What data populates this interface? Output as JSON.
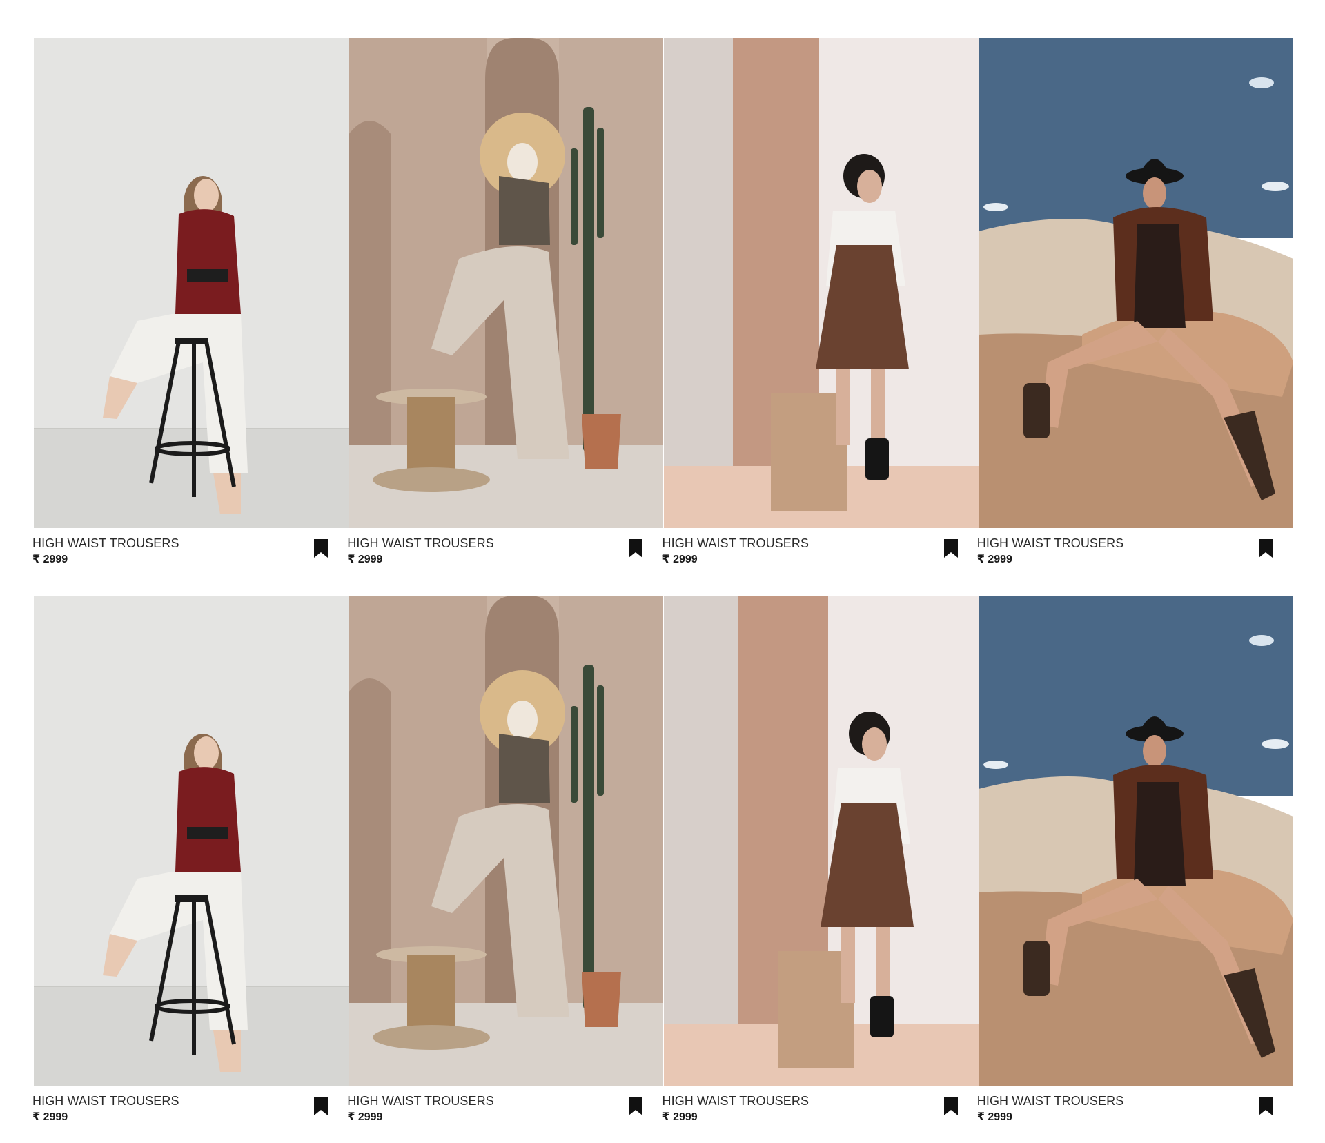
{
  "products": [
    {
      "name": "HIGH WAIST TROUSERS",
      "currency": "₹",
      "price": "2999",
      "photo": "model-red-sweater-stool",
      "icon": "bookmark-icon"
    },
    {
      "name": "HIGH WAIST TROUSERS",
      "currency": "₹",
      "price": "2999",
      "photo": "model-straw-hat-cactus",
      "icon": "bookmark-icon"
    },
    {
      "name": "HIGH WAIST TROUSERS",
      "currency": "₹",
      "price": "2999",
      "photo": "model-leather-dress-pink-wall",
      "icon": "bookmark-icon"
    },
    {
      "name": "HIGH WAIST TROUSERS",
      "currency": "₹",
      "price": "2999",
      "photo": "model-cowboy-hat-desert",
      "icon": "bookmark-icon"
    },
    {
      "name": "HIGH WAIST TROUSERS",
      "currency": "₹",
      "price": "2999",
      "photo": "model-red-sweater-stool",
      "icon": "bookmark-icon"
    },
    {
      "name": "HIGH WAIST TROUSERS",
      "currency": "₹",
      "price": "2999",
      "photo": "model-straw-hat-cactus",
      "icon": "bookmark-icon"
    },
    {
      "name": "HIGH WAIST TROUSERS",
      "currency": "₹",
      "price": "2999",
      "photo": "model-leather-dress-pink-wall",
      "icon": "bookmark-icon"
    },
    {
      "name": "HIGH WAIST TROUSERS",
      "currency": "₹",
      "price": "2999",
      "photo": "model-cowboy-hat-desert",
      "icon": "bookmark-icon"
    }
  ]
}
